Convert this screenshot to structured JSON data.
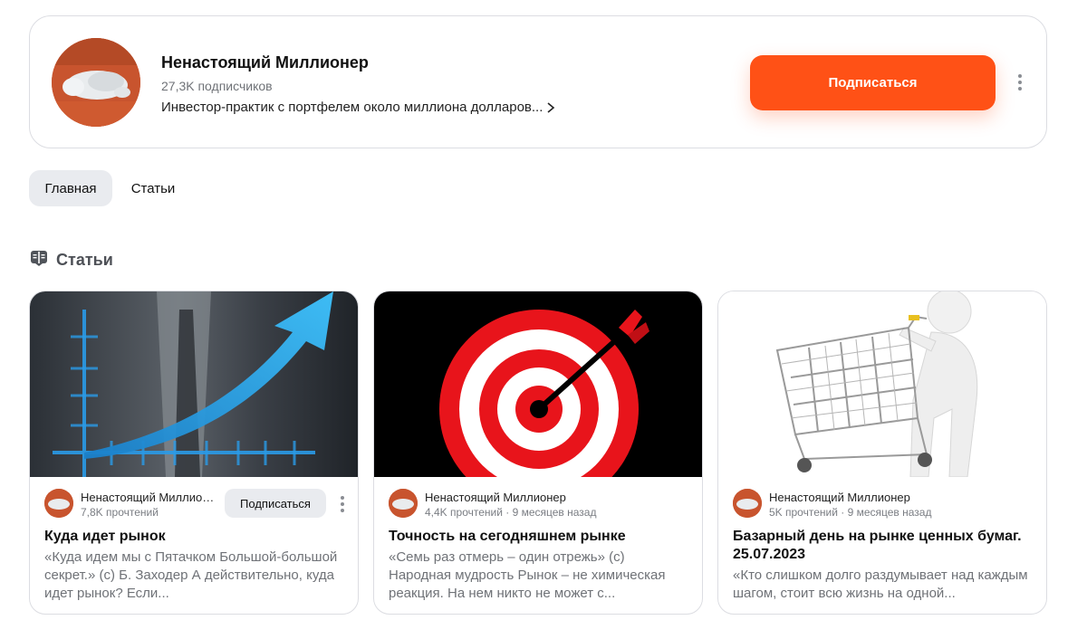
{
  "channel": {
    "name": "Ненастоящий Миллионер",
    "subscribers": "27,3K подписчиков",
    "description": "Инвестор-практик с портфелем около миллиона долларов...",
    "subscribe_label": "Подписаться"
  },
  "tabs": [
    {
      "label": "Главная",
      "active": true
    },
    {
      "label": "Статьи",
      "active": false
    }
  ],
  "section": {
    "title": "Статьи",
    "icon": "book-open-icon"
  },
  "articles": [
    {
      "author": "Ненастоящий Миллионер",
      "meta": "7,8K прочтений",
      "subscribe_label": "Подписаться",
      "title": "Куда идет рынок",
      "snippet": "«Куда идем мы с Пятачком Большой-большой секрет.» (с) Б. Заходер А действительно, куда идет рынок? Если...",
      "image": "business-growth-chart"
    },
    {
      "author": "Ненастоящий Миллионер",
      "meta": "4,4K прочтений · 9 месяцев назад",
      "title": "Точность на сегодняшнем рынке",
      "snippet": "«Семь раз отмерь – один отрежь» (с) Народная мудрость Рынок – не химическая реакция. На нем никто не может с...",
      "image": "target-with-arrow"
    },
    {
      "author": "Ненастоящий Миллионер",
      "meta": "5K прочтений · 9 месяцев назад",
      "title": "Базарный день на рынке ценных бумаг. 25.07.2023",
      "snippet": "«Кто слишком долго раздумывает над каждым шагом, стоит всю жизнь на одной...",
      "image": "shopping-cart-figure"
    }
  ],
  "colors": {
    "accent": "#ff5116",
    "muted_bg": "#e9ebef",
    "text_muted": "#6f7277"
  }
}
